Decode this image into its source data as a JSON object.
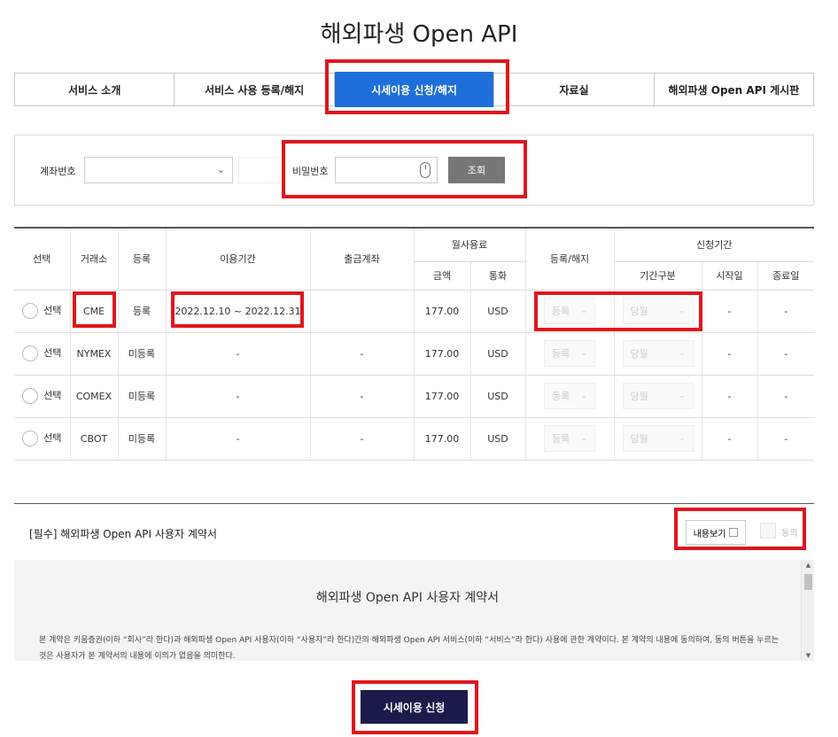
{
  "page_title": "해외파생 Open API",
  "tabs": [
    {
      "label": "서비스 소개"
    },
    {
      "label": "서비스 사용 등록/해지"
    },
    {
      "label": "시세이용 신청/해지"
    },
    {
      "label": "자료실"
    },
    {
      "label": "해외파생 Open API 게시판"
    }
  ],
  "search": {
    "account_label": "계좌번호",
    "account_value": "",
    "password_label": "비밀번호",
    "password_value": "",
    "search_button": "조회"
  },
  "table": {
    "headers": {
      "select": "선택",
      "exchange": "거래소",
      "registration": "등록",
      "period": "이용기간",
      "withdraw_account": "출금계좌",
      "monthly_fee": "월사용료",
      "amount": "금액",
      "currency": "통화",
      "reg_cancel": "등록/해지",
      "apply_period": "신청기간",
      "period_type": "기간구분",
      "start_date": "시작일",
      "end_date": "종료일"
    },
    "rows": [
      {
        "select_label": "선택",
        "exchange": "CME",
        "status": "등록",
        "period": "2022.12.10 ~ 2022.12.31",
        "account": "",
        "amount": "177.00",
        "currency": "USD",
        "reg_select": "등록",
        "period_select": "당월",
        "start": "-",
        "end": "-"
      },
      {
        "select_label": "선택",
        "exchange": "NYMEX",
        "status": "미등록",
        "period": "-",
        "account": "-",
        "amount": "177.00",
        "currency": "USD",
        "reg_select": "등록",
        "period_select": "당월",
        "start": "-",
        "end": "-"
      },
      {
        "select_label": "선택",
        "exchange": "COMEX",
        "status": "미등록",
        "period": "-",
        "account": "-",
        "amount": "177.00",
        "currency": "USD",
        "reg_select": "등록",
        "period_select": "당월",
        "start": "-",
        "end": "-"
      },
      {
        "select_label": "선택",
        "exchange": "CBOT",
        "status": "미등록",
        "period": "-",
        "account": "-",
        "amount": "177.00",
        "currency": "USD",
        "reg_select": "등록",
        "period_select": "당월",
        "start": "-",
        "end": "-"
      }
    ]
  },
  "agreement": {
    "title": "[필수] 해외파생 Open API 사용자 계약서",
    "view_button": "내용보기",
    "agree_label": "동의",
    "doc_title": "해외파생 Open API 사용자 계약서",
    "doc_text": "본 계약은 키움증권(이하 “회사”라 한다)과 해외파생 Open API 사용자(이하 “사용자”라 한다)간의 해외파생 Open API 서비스(이하 “서비스”라 한다) 사용에 관한 계약이다. 본 계약의 내용에 동의하여, 동의 버튼을 누르는 것은 사용자가 본 계약서의 내용에 이의가 없음을 의미한다."
  },
  "apply_button": "시세이용 신청",
  "colors": {
    "active_tab": "#1e6fd9",
    "apply_button": "#1b1b4b",
    "search_button": "#777777",
    "annotation": "#e0161e"
  }
}
